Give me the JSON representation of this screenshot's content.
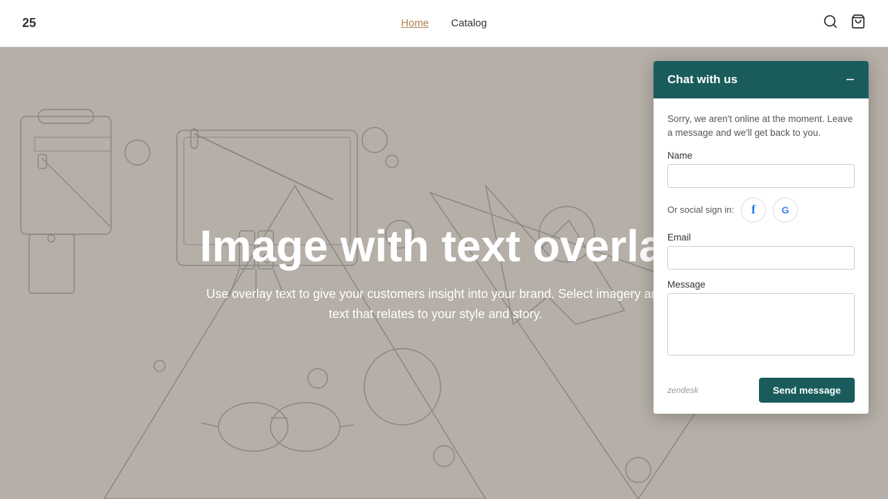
{
  "brand": "25",
  "nav": {
    "links": [
      {
        "label": "Home",
        "active": true
      },
      {
        "label": "Catalog",
        "active": false
      }
    ],
    "search_icon": "🔍",
    "cart_icon": "🛍"
  },
  "hero": {
    "title": "Image with text overlay",
    "subtitle": "Use overlay text to give your customers insight into your brand. Select imagery and text that relates to your style and story."
  },
  "chat": {
    "header": "Chat with us",
    "minimize_label": "−",
    "message": "Sorry, we aren't online at the moment. Leave a message and we'll get back to you.",
    "name_label": "Name",
    "name_placeholder": "",
    "social_label": "Or social sign in:",
    "email_label": "Email",
    "email_placeholder": "",
    "message_label": "Message",
    "message_placeholder": "",
    "zendesk_label": "zendesk",
    "send_button": "Send message"
  }
}
